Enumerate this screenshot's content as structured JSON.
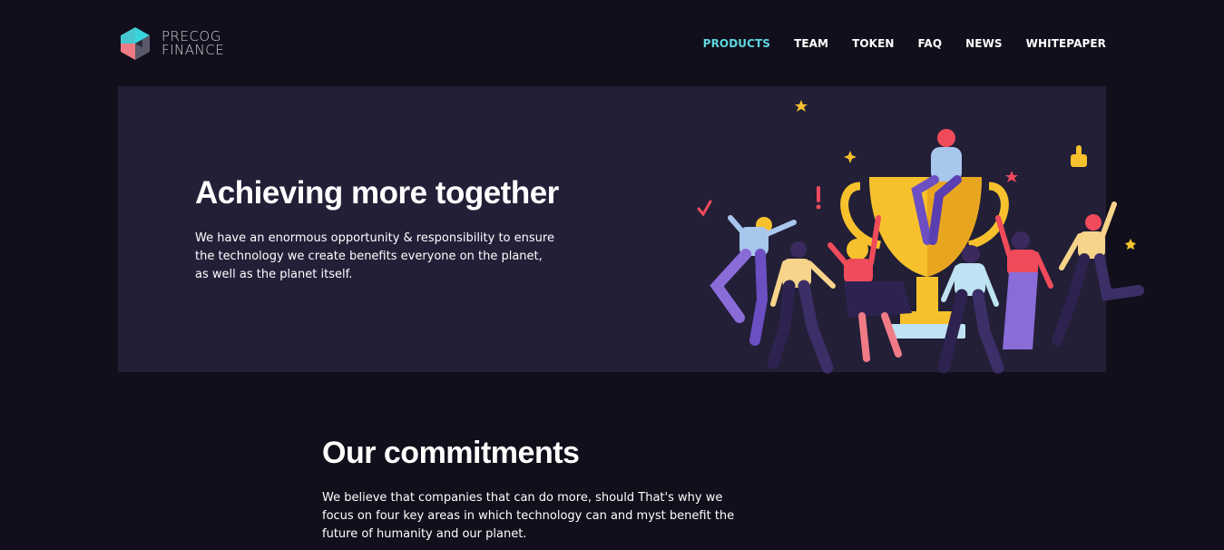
{
  "brand": {
    "line1": "PRECOG",
    "line2": "FINANCE"
  },
  "nav": {
    "items": [
      {
        "label": "PRODUCTS",
        "active": true
      },
      {
        "label": "TEAM",
        "active": false
      },
      {
        "label": "TOKEN",
        "active": false
      },
      {
        "label": "FAQ",
        "active": false
      },
      {
        "label": "NEWS",
        "active": false
      },
      {
        "label": "WHITEPAPER",
        "active": false
      }
    ]
  },
  "hero": {
    "title": "Achieving more together",
    "text": "We have an enormous opportunity & responsibility to ensure the technology we create benefits everyone on the planet, as well as the planet itself.",
    "illustration": "team-celebrating-trophy-illustration"
  },
  "commitments": {
    "title": "Our commitments",
    "text": "We believe that companies that can do more, should That's why we focus on four key areas in which technology can and myst benefit the future of humanity and our planet."
  },
  "colors": {
    "background": "#110f1b",
    "hero_panel": "#221f37",
    "accent": "#5fd7e0",
    "logo_teal": "#3ad4dc",
    "logo_coral": "#f07b86",
    "trophy_gold": "#f6c12c"
  }
}
